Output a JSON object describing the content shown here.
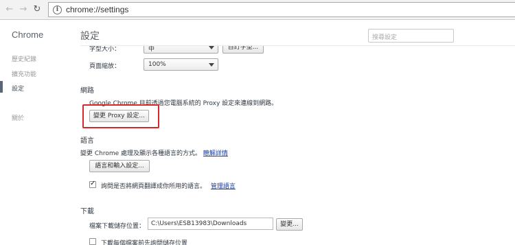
{
  "browser": {
    "url": "chrome://settings",
    "back_icon": "back-arrow-icon",
    "forward_icon": "forward-arrow-icon",
    "reload_icon": "reload-icon",
    "info_icon": "info-icon",
    "info_glyph": "i"
  },
  "sidebar": {
    "brand": "Chrome",
    "items": [
      {
        "label": "歷史紀錄"
      },
      {
        "label": "擴充功能"
      },
      {
        "label": "設定"
      },
      {
        "label": "關於"
      }
    ]
  },
  "header": {
    "title": "設定",
    "search_placeholder": "搜尋設定"
  },
  "appearance": {
    "font_size_label": "字型大小：",
    "font_size_value": "中",
    "custom_fonts_button": "自訂字型...",
    "zoom_label": "頁面縮放：",
    "zoom_value": "100%"
  },
  "network": {
    "title": "網路",
    "description": "Google Chrome 目前透過您電腦系統的 Proxy 設定來連線到網路。",
    "proxy_button": "變更 Proxy 設定..."
  },
  "language": {
    "title": "語言",
    "description": "變更 Chrome 處理及顯示各種語言的方式。",
    "learn_more": "瞭解詳情",
    "settings_button": "語言和輸入設定...",
    "translate_label": "詢問是否將網頁翻譯成你所用的語言。",
    "translate_checked": true,
    "manage_languages": "管理語言"
  },
  "downloads": {
    "title": "下載",
    "location_label": "檔案下載儲存位置：",
    "location_value": "C:\\Users\\ESB13983\\Downloads",
    "change_button": "變更...",
    "ask_label": "下載每個檔案前先詢問儲存位置",
    "ask_checked": false
  }
}
